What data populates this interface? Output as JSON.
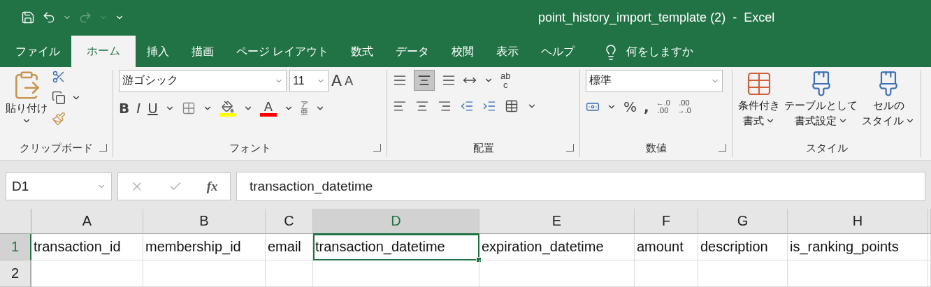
{
  "window": {
    "title": "point_history_import_template (2)  -  Excel"
  },
  "tabs": [
    {
      "label": "ファイル",
      "selected": false
    },
    {
      "label": "ホーム",
      "selected": true
    },
    {
      "label": "挿入",
      "selected": false
    },
    {
      "label": "描画",
      "selected": false
    },
    {
      "label": "ページ レイアウト",
      "selected": false
    },
    {
      "label": "数式",
      "selected": false
    },
    {
      "label": "データ",
      "selected": false
    },
    {
      "label": "校閲",
      "selected": false
    },
    {
      "label": "表示",
      "selected": false
    },
    {
      "label": "ヘルプ",
      "selected": false
    }
  ],
  "tell_me": "何をしますか",
  "clipboard": {
    "paste": "貼り付け",
    "label": "クリップボード"
  },
  "font": {
    "name": "游ゴシック",
    "size": "11",
    "grow": "A",
    "shrink": "A",
    "bold": "B",
    "italic": "I",
    "underline": "U",
    "font_color": "A",
    "phonetic_top": "ア",
    "phonetic_bottom": "亜",
    "label": "フォント"
  },
  "alignment": {
    "wrap_top": "ab",
    "wrap_bottom": "c",
    "label": "配置"
  },
  "number": {
    "format": "標準",
    "percent": "%",
    "comma": ",",
    "increase_top": "←.0",
    "increase_bottom": ".00",
    "decrease_top": ".00",
    "decrease_bottom": "→.0",
    "label": "数値"
  },
  "styles": {
    "buttons": [
      {
        "line1": "条件付き",
        "line2": "書式"
      },
      {
        "line1": "テーブルとして",
        "line2": "書式設定"
      },
      {
        "line1": "セルの",
        "line2": "スタイル"
      }
    ],
    "label": "スタイル"
  },
  "formula_bar": {
    "name_box": "D1",
    "fx": "fx",
    "value": "transaction_datetime"
  },
  "sheet": {
    "columns": [
      {
        "label": "A",
        "selected": false
      },
      {
        "label": "B",
        "selected": false
      },
      {
        "label": "C",
        "selected": false
      },
      {
        "label": "D",
        "selected": true
      },
      {
        "label": "E",
        "selected": false
      },
      {
        "label": "F",
        "selected": false
      },
      {
        "label": "G",
        "selected": false
      },
      {
        "label": "H",
        "selected": false
      }
    ],
    "rows": [
      {
        "label": "1",
        "selected": true,
        "cells": [
          {
            "text": "transaction_id",
            "selected": false
          },
          {
            "text": "membership_id",
            "selected": false
          },
          {
            "text": "email",
            "selected": false
          },
          {
            "text": "transaction_datetime",
            "selected": true
          },
          {
            "text": "expiration_datetime",
            "selected": false
          },
          {
            "text": "amount",
            "selected": false
          },
          {
            "text": "description",
            "selected": false
          },
          {
            "text": "is_ranking_points",
            "selected": false
          }
        ]
      },
      {
        "label": "2",
        "selected": false,
        "cells": []
      }
    ]
  }
}
